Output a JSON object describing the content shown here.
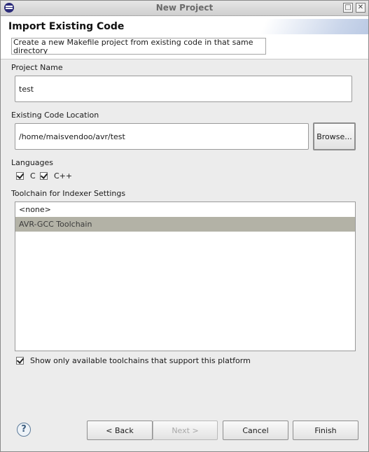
{
  "window": {
    "title": "New Project"
  },
  "header": {
    "title": "Import Existing Code",
    "message": "Create a new Makefile project from existing code in that same directory"
  },
  "project_name": {
    "label": "Project Name",
    "value": "test"
  },
  "location": {
    "label": "Existing Code Location",
    "value": "/home/maisvendoo/avr/test",
    "browse_label": "Browse..."
  },
  "languages": {
    "label": "Languages",
    "c_label": "C",
    "cpp_label": "C++",
    "c_checked": true,
    "cpp_checked": true
  },
  "toolchain": {
    "label": "Toolchain for Indexer Settings",
    "items": [
      "<none>",
      "AVR-GCC Toolchain"
    ],
    "selected": "AVR-GCC Toolchain",
    "filter_label": "Show only available toolchains that support this platform",
    "filter_checked": true
  },
  "buttons": {
    "back": "< Back",
    "next": "Next >",
    "cancel": "Cancel",
    "finish": "Finish"
  },
  "help": {
    "glyph": "?"
  }
}
